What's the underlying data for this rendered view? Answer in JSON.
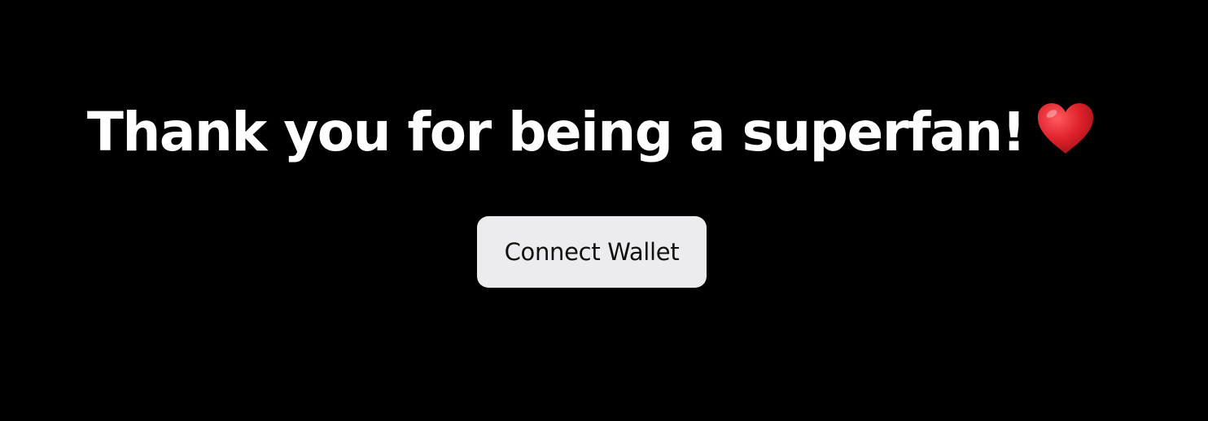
{
  "main": {
    "headline": "Thank you for being a superfan!",
    "headline_icon": "heart-icon",
    "connect_button_label": "Connect Wallet"
  },
  "colors": {
    "background": "#000000",
    "headline_text": "#ffffff",
    "button_background": "#ececee",
    "button_text": "#111111",
    "heart": "#e0222b"
  }
}
